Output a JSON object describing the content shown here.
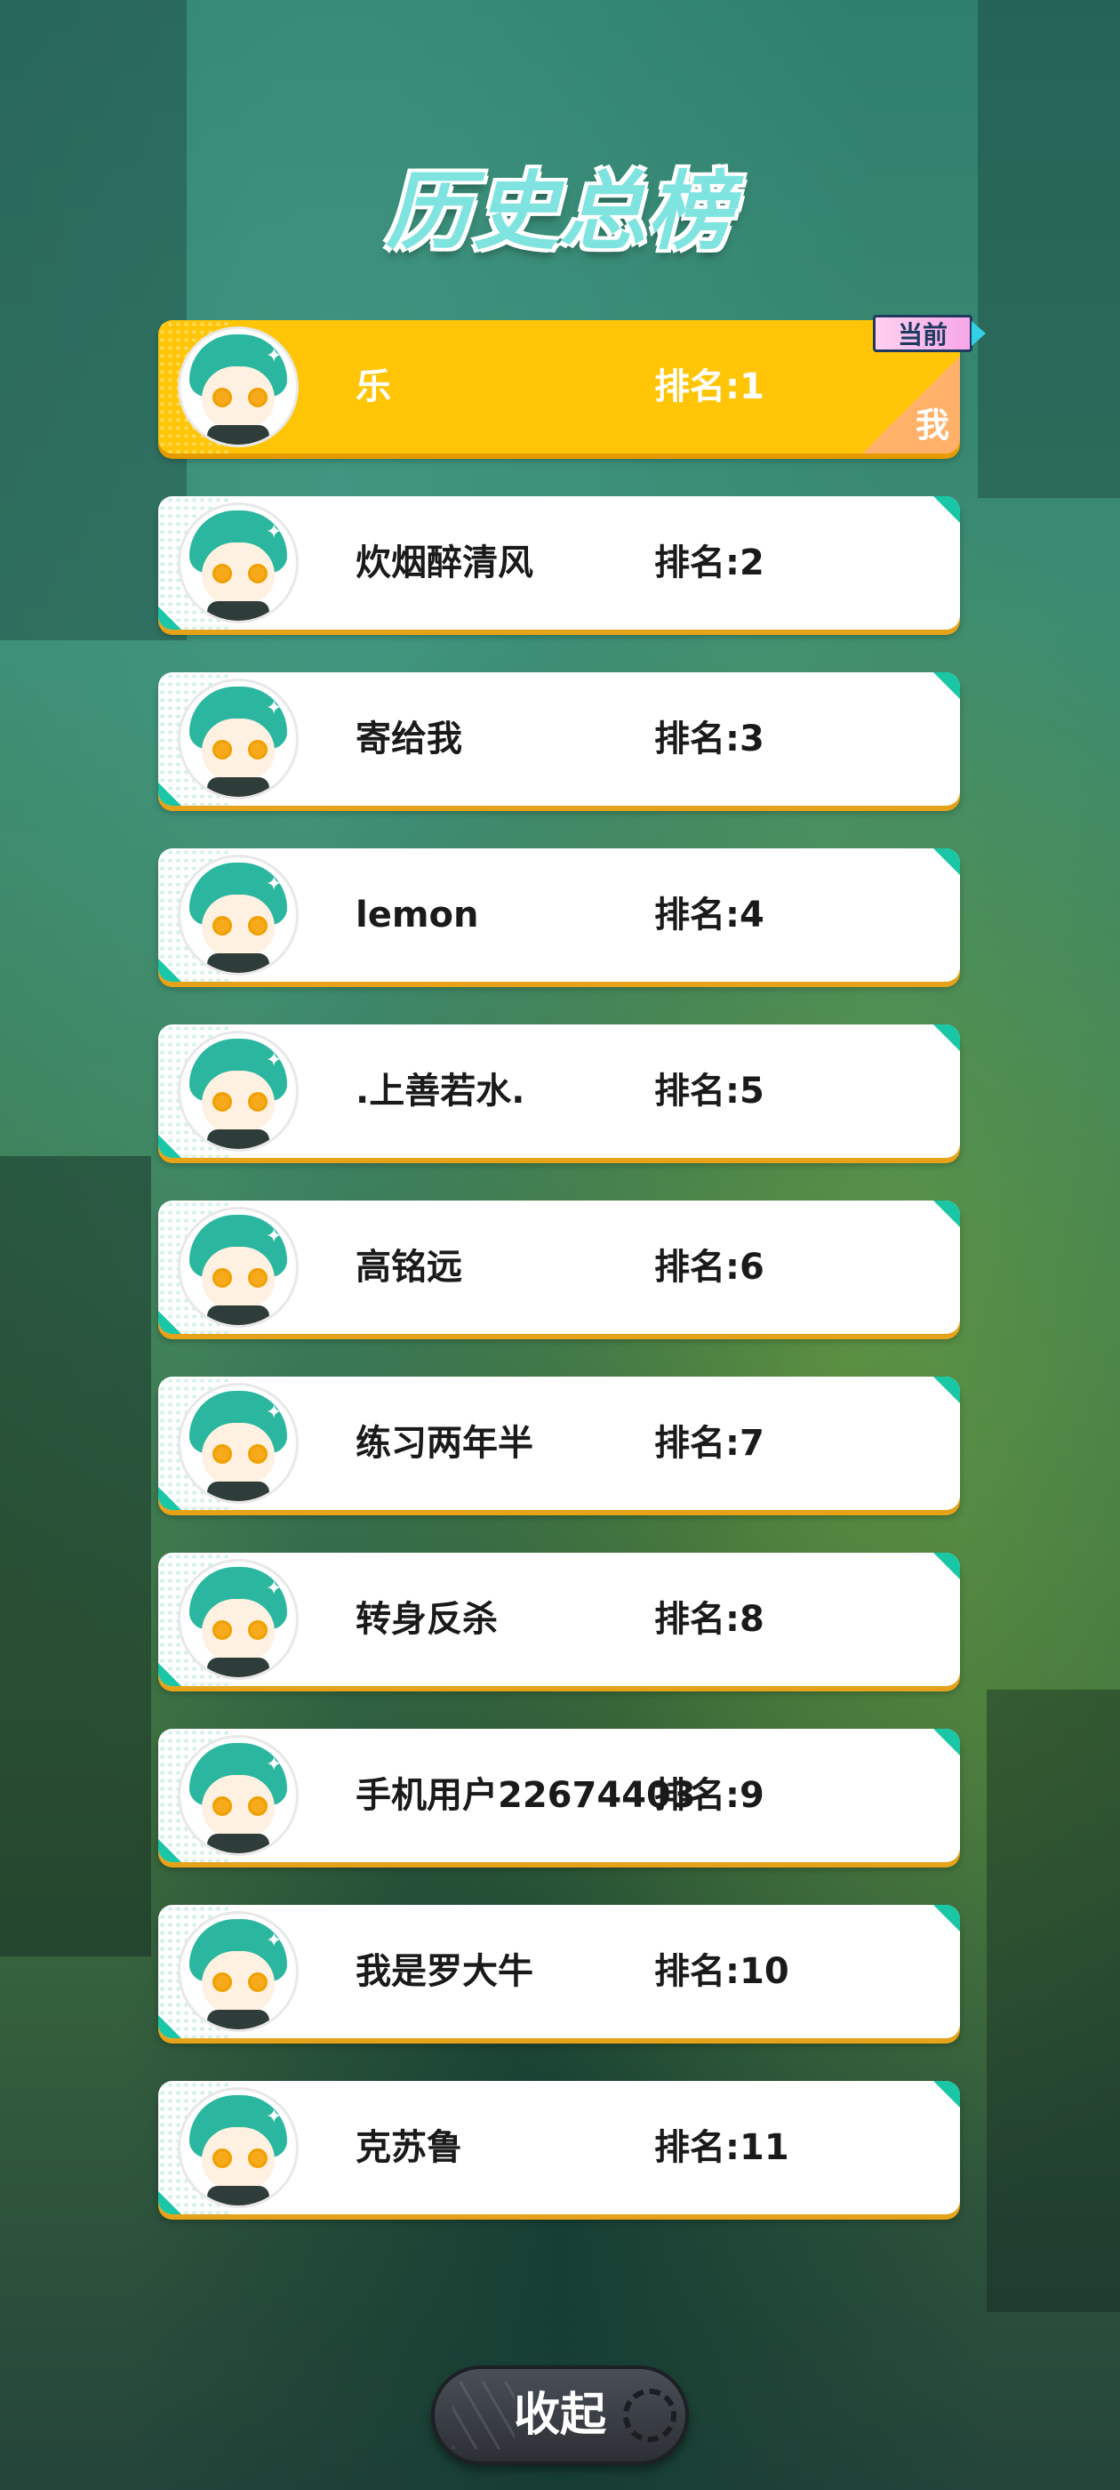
{
  "title": "历史总榜",
  "current_badge": "当前",
  "me_label": "我",
  "rows": [
    {
      "name": "乐",
      "rank": "排名:1",
      "is_me": true
    },
    {
      "name": "炊烟醉清风",
      "rank": "排名:2"
    },
    {
      "name": "寄给我",
      "rank": "排名:3"
    },
    {
      "name": "lemon",
      "rank": "排名:4"
    },
    {
      "name": ".上善若水.",
      "rank": "排名:5"
    },
    {
      "name": "高铭远",
      "rank": "排名:6"
    },
    {
      "name": "练习两年半",
      "rank": "排名:7"
    },
    {
      "name": "转身反杀",
      "rank": "排名:8"
    },
    {
      "name": "手机用户22674403",
      "rank": "排名:9"
    },
    {
      "name": "我是罗大牛",
      "rank": "排名:10"
    },
    {
      "name": "克苏鲁",
      "rank": "排名:11"
    }
  ],
  "collapse_button": "收起",
  "colors": {
    "me_row": "#ffc506",
    "row": "#ffffff",
    "accent": "#19c6a6",
    "title": "#7fe3e0"
  }
}
